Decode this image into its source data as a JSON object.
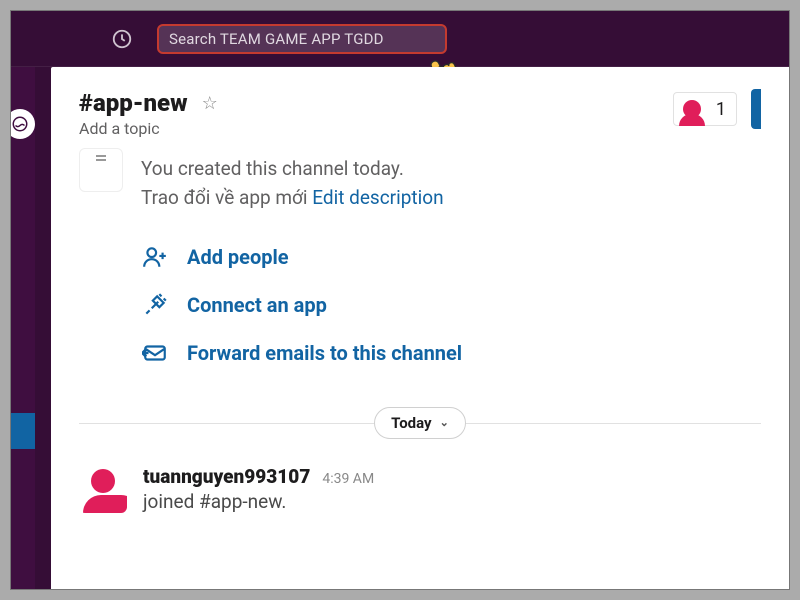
{
  "topbar": {
    "search_placeholder": "Search TEAM GAME APP TGDD"
  },
  "channel": {
    "name": "#app-new",
    "topic_placeholder": "Add a topic",
    "created_line": "You created this channel today.",
    "description_prefix": "Trao đổi về app mới ",
    "edit_description": "Edit description",
    "member_count": "1"
  },
  "actions": {
    "add_people": "Add people",
    "connect_app": "Connect an app",
    "forward_emails": "Forward emails to this channel"
  },
  "date_separator": {
    "label": "Today"
  },
  "message": {
    "user": "tuannguyen993107",
    "time": "4:39 AM",
    "text": "joined #app-new."
  }
}
